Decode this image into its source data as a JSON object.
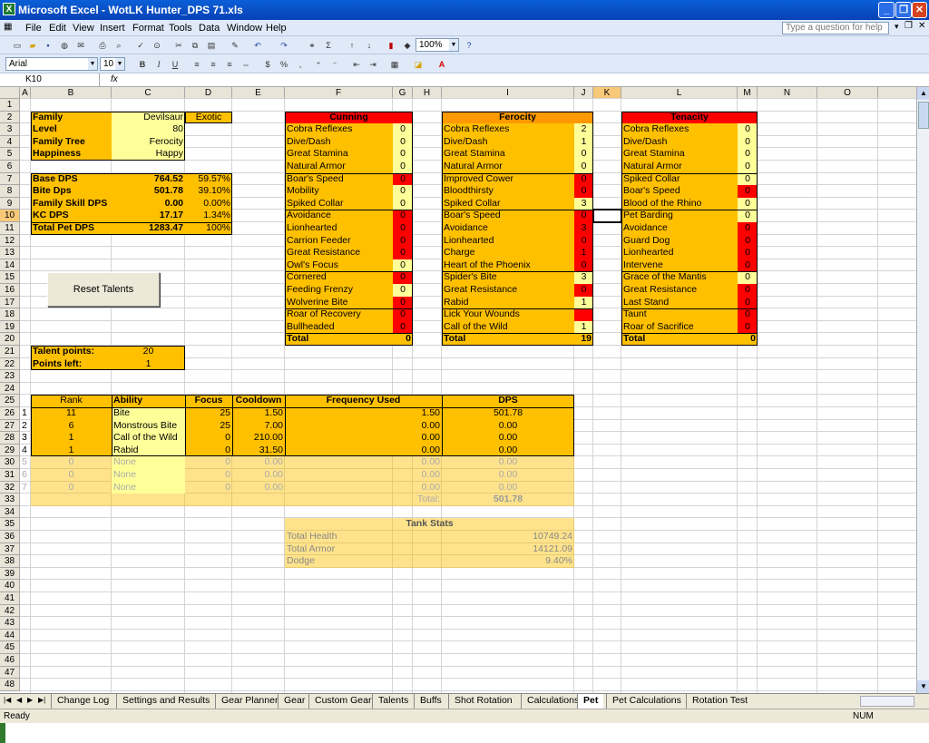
{
  "window": {
    "title": "Microsoft Excel - WotLK Hunter_DPS 71.xls",
    "app_icon": "excel-icon"
  },
  "menu": {
    "items": [
      "File",
      "Edit",
      "View",
      "Insert",
      "Format",
      "Tools",
      "Data",
      "Window",
      "Help"
    ],
    "help_placeholder": "Type a question for help"
  },
  "toolbar": {
    "zoom": "100%",
    "font": "Arial",
    "font_size": "10"
  },
  "formula_bar": {
    "name_box": "K10",
    "fx": "fx"
  },
  "columns": [
    "A",
    "B",
    "C",
    "D",
    "E",
    "F",
    "G",
    "H",
    "I",
    "J",
    "K",
    "L",
    "M",
    "N",
    "O"
  ],
  "selected_cell": "K10",
  "family_table": {
    "rows": [
      {
        "label": "Family",
        "value": "Devilsaur",
        "extra": "Exotic"
      },
      {
        "label": "Level",
        "value": "80"
      },
      {
        "label": "Family Tree",
        "value": "Ferocity"
      },
      {
        "label": "Happiness",
        "value": "Happy"
      }
    ]
  },
  "dps_table": {
    "rows": [
      {
        "label": "Base DPS",
        "value": "764.52",
        "pct": "59.57%"
      },
      {
        "label": "Bite Dps",
        "value": "501.78",
        "pct": "39.10%"
      },
      {
        "label": "Family Skill DPS",
        "value": "0.00",
        "pct": "0.00%"
      },
      {
        "label": "KC DPS",
        "value": "17.17",
        "pct": "1.34%"
      },
      {
        "label": "Total Pet DPS",
        "value": "1283.47",
        "pct": "100%"
      }
    ]
  },
  "reset_button": "Reset Talents",
  "talent_points": {
    "label1": "Talent points:",
    "value1": "20",
    "label2": "Points left:",
    "value2": "1"
  },
  "cunning": {
    "title": "Cunning",
    "rows": [
      {
        "name": "Cobra Reflexes",
        "val": "0",
        "red": false
      },
      {
        "name": "Dive/Dash",
        "val": "0",
        "red": false
      },
      {
        "name": "Great Stamina",
        "val": "0",
        "red": false
      },
      {
        "name": "Natural Armor",
        "val": "0",
        "red": false
      },
      {
        "name": "Boar's Speed",
        "val": "0",
        "red": true
      },
      {
        "name": "Mobility",
        "val": "0",
        "red": false
      },
      {
        "name": "Spiked Collar",
        "val": "0",
        "red": false
      },
      {
        "name": "Avoidance",
        "val": "0",
        "red": true
      },
      {
        "name": "Lionhearted",
        "val": "0",
        "red": true
      },
      {
        "name": "Carrion Feeder",
        "val": "0",
        "red": true
      },
      {
        "name": "Great Resistance",
        "val": "0",
        "red": true
      },
      {
        "name": "Owl's Focus",
        "val": "0",
        "red": false
      },
      {
        "name": "Cornered",
        "val": "0",
        "red": true
      },
      {
        "name": "Feeding Frenzy",
        "val": "0",
        "red": false
      },
      {
        "name": "Wolverine Bite",
        "val": "0",
        "red": true
      },
      {
        "name": "Roar of Recovery",
        "val": "0",
        "red": true
      },
      {
        "name": "Bullheaded",
        "val": "0",
        "red": true
      }
    ],
    "total_label": "Total",
    "total": "0"
  },
  "ferocity": {
    "title": "Ferocity",
    "rows": [
      {
        "name": "Cobra Reflexes",
        "val": "2",
        "red": false
      },
      {
        "name": "Dive/Dash",
        "val": "1",
        "red": false
      },
      {
        "name": "Great Stamina",
        "val": "0",
        "red": false
      },
      {
        "name": "Natural Armor",
        "val": "0",
        "red": false
      },
      {
        "name": "Improved Cower",
        "val": "0",
        "red": true
      },
      {
        "name": "Bloodthirsty",
        "val": "0",
        "red": true
      },
      {
        "name": "Spiked Collar",
        "val": "3",
        "red": false
      },
      {
        "name": "Boar's Speed",
        "val": "0",
        "red": true
      },
      {
        "name": "Avoidance",
        "val": "3",
        "red": true
      },
      {
        "name": "Lionhearted",
        "val": "0",
        "red": true
      },
      {
        "name": "Charge",
        "val": "1",
        "red": true
      },
      {
        "name": "Heart of the Phoenix",
        "val": "0",
        "red": true
      },
      {
        "name": "Spider's Bite",
        "val": "3",
        "red": false
      },
      {
        "name": "Great Resistance",
        "val": "0",
        "red": true
      },
      {
        "name": "Rabid",
        "val": "1",
        "red": false
      },
      {
        "name": "Lick Your Wounds",
        "val": "",
        "red": true
      },
      {
        "name": "Call of the Wild",
        "val": "1",
        "red": false
      }
    ],
    "total_label": "Total",
    "total": "19"
  },
  "tenacity": {
    "title": "Tenacity",
    "rows": [
      {
        "name": "Cobra Reflexes",
        "val": "0",
        "red": false
      },
      {
        "name": "Dive/Dash",
        "val": "0",
        "red": false
      },
      {
        "name": "Great Stamina",
        "val": "0",
        "red": false
      },
      {
        "name": "Natural Armor",
        "val": "0",
        "red": false
      },
      {
        "name": "Spiked Collar",
        "val": "0",
        "red": false
      },
      {
        "name": "Boar's Speed",
        "val": "0",
        "red": true
      },
      {
        "name": "Blood of the Rhino",
        "val": "0",
        "red": false
      },
      {
        "name": "Pet Barding",
        "val": "0",
        "red": false
      },
      {
        "name": "Avoidance",
        "val": "0",
        "red": true
      },
      {
        "name": "Guard Dog",
        "val": "0",
        "red": true
      },
      {
        "name": "Lionhearted",
        "val": "0",
        "red": true
      },
      {
        "name": "Intervene",
        "val": "0",
        "red": true
      },
      {
        "name": "Grace of the Mantis",
        "val": "0",
        "red": false
      },
      {
        "name": "Great Resistance",
        "val": "0",
        "red": true
      },
      {
        "name": "Last Stand",
        "val": "0",
        "red": true
      },
      {
        "name": "Taunt",
        "val": "0",
        "red": true
      },
      {
        "name": "Roar of Sacrifice",
        "val": "0",
        "red": true
      }
    ],
    "total_label": "Total",
    "total": "0"
  },
  "ability_table": {
    "headers": [
      "Rank",
      "Ability",
      "Focus",
      "Cooldown",
      "Frequency Used",
      "DPS"
    ],
    "rows": [
      {
        "idx": "1",
        "rank": "11",
        "ability": "Bite",
        "focus": "25",
        "cooldown": "1.50",
        "freq": "1.50",
        "dps": "501.78",
        "faded": false
      },
      {
        "idx": "2",
        "rank": "6",
        "ability": "Monstrous Bite",
        "focus": "25",
        "cooldown": "7.00",
        "freq": "0.00",
        "dps": "0.00",
        "faded": false
      },
      {
        "idx": "3",
        "rank": "1",
        "ability": "Call of the Wild",
        "focus": "0",
        "cooldown": "210.00",
        "freq": "0.00",
        "dps": "0.00",
        "faded": false
      },
      {
        "idx": "4",
        "rank": "1",
        "ability": "Rabid",
        "focus": "0",
        "cooldown": "31.50",
        "freq": "0.00",
        "dps": "0.00",
        "faded": false
      },
      {
        "idx": "5",
        "rank": "0",
        "ability": "None",
        "focus": "0",
        "cooldown": "0.00",
        "freq": "0.00",
        "dps": "0.00",
        "faded": true
      },
      {
        "idx": "6",
        "rank": "0",
        "ability": "None",
        "focus": "0",
        "cooldown": "0.00",
        "freq": "0.00",
        "dps": "0.00",
        "faded": true
      },
      {
        "idx": "7",
        "rank": "0",
        "ability": "None",
        "focus": "0",
        "cooldown": "0.00",
        "freq": "0.00",
        "dps": "0.00",
        "faded": true
      }
    ],
    "total_label": "Total:",
    "total": "501.78"
  },
  "tank_stats": {
    "title": "Tank Stats",
    "rows": [
      {
        "label": "Total Health",
        "value": "10749.24"
      },
      {
        "label": "Total Armor",
        "value": "14121.09"
      },
      {
        "label": "Dodge",
        "value": "9.40%"
      }
    ]
  },
  "sheet_tabs": [
    "Change Log",
    "Settings and Results",
    "Gear Planner",
    "Gear",
    "Custom Gear",
    "Talents",
    "Buffs",
    "Shot Rotation",
    "Calculations",
    "Pet",
    "Pet Calculations",
    "Rotation Test"
  ],
  "active_tab": "Pet",
  "status": {
    "ready": "Ready",
    "num": "NUM"
  },
  "colors": {
    "gold": "#ffc000",
    "light_yellow": "#ffff99",
    "red": "#ff0000",
    "orange_header": "#ff9900"
  }
}
